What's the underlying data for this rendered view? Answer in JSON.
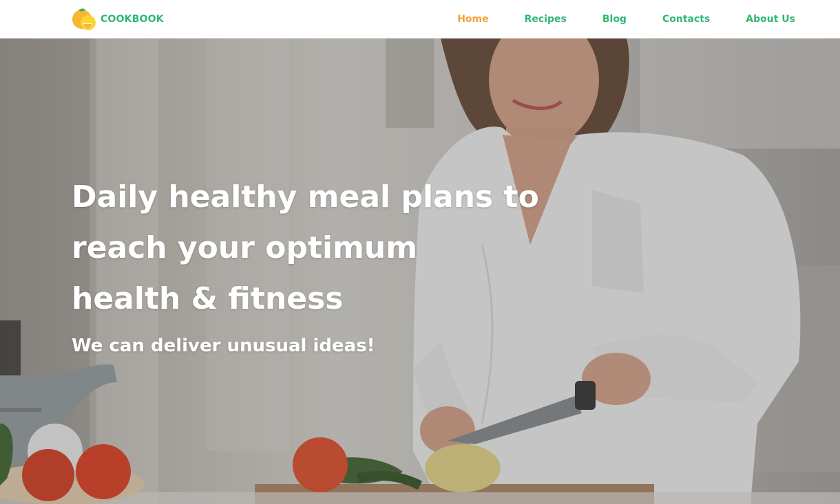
{
  "header": {
    "brand": "COOKBOOK",
    "nav": [
      {
        "label": "Home",
        "active": true
      },
      {
        "label": "Recipes",
        "active": false
      },
      {
        "label": "Blog",
        "active": false
      },
      {
        "label": "Contacts",
        "active": false
      },
      {
        "label": "About Us",
        "active": false
      }
    ]
  },
  "hero": {
    "title_lines": [
      "Daily healthy meal plans to",
      "reach your optimum",
      "health & fitness"
    ],
    "subtitle": "We can deliver unusual ideas!",
    "image": "woman-slicing-vegetables-in-kitchen"
  },
  "colors": {
    "brand_green": "#2eb872",
    "active_orange": "#f4a038",
    "hero_text": "#ffffff"
  },
  "icons": {
    "logo": "citrus-fruit-logo-icon"
  }
}
